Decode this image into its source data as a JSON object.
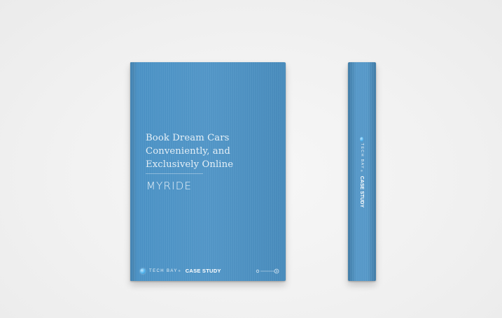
{
  "cover": {
    "title_lines": [
      "Book Dream Cars",
      "Conveniently, and",
      "Exclusively Online"
    ],
    "brand": "MYRIDE",
    "publisher": "TECH BAY",
    "publisher_mark": "®",
    "series": "CASE STUDY",
    "color": "#4b93c7"
  },
  "spine": {
    "publisher": "TECH BAY",
    "publisher_mark": "®",
    "series": "CASE STUDY"
  },
  "icons": {
    "logo": "tech-bay-logo-dot",
    "navigation": "pager-arrow-graphic"
  }
}
